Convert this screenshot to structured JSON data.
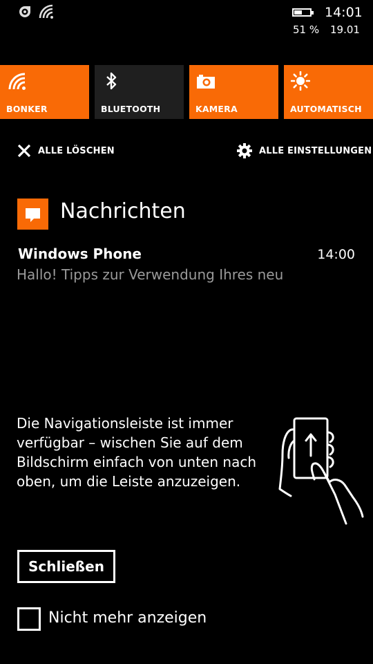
{
  "status_bar": {
    "time": "14:01",
    "battery_percent": "51 %",
    "battery_level": 0.51,
    "date": "19.01",
    "icons": [
      "nfc-icon",
      "wifi-icon",
      "battery-icon"
    ]
  },
  "quick_actions": [
    {
      "label": "BONKER",
      "icon": "wifi-icon",
      "color": "#f96a06"
    },
    {
      "label": "BLUETOOTH",
      "icon": "bluetooth-icon",
      "color": "#1f1f1f"
    },
    {
      "label": "KAMERA",
      "icon": "camera-icon",
      "color": "#f96a06"
    },
    {
      "label": "AUTOMATISCH",
      "icon": "brightness-icon",
      "color": "#f96a06"
    }
  ],
  "actions": {
    "clear_all": "ALLE LÖSCHEN",
    "all_settings": "ALLE EINSTELLUNGEN"
  },
  "notifications": {
    "app_name": "Nachrichten",
    "app_icon": "message-icon",
    "items": [
      {
        "title": "Windows Phone",
        "time": "14:00",
        "body": "Hallo! Tipps zur Verwendung Ihres neu"
      }
    ]
  },
  "hint": {
    "text": "Die Navigationsleiste ist immer verfügbar – wischen Sie auf dem Bildschirm einfach von unten nach oben, um die Leiste anzuzeigen.",
    "illustration": "swipe-up-hand-icon",
    "close_label": "Schließen",
    "checkbox_label": "Nicht mehr anzeigen",
    "checkbox_checked": false
  },
  "colors": {
    "accent": "#f96a06",
    "background": "#000000",
    "muted_text": "#9a9a9a"
  }
}
